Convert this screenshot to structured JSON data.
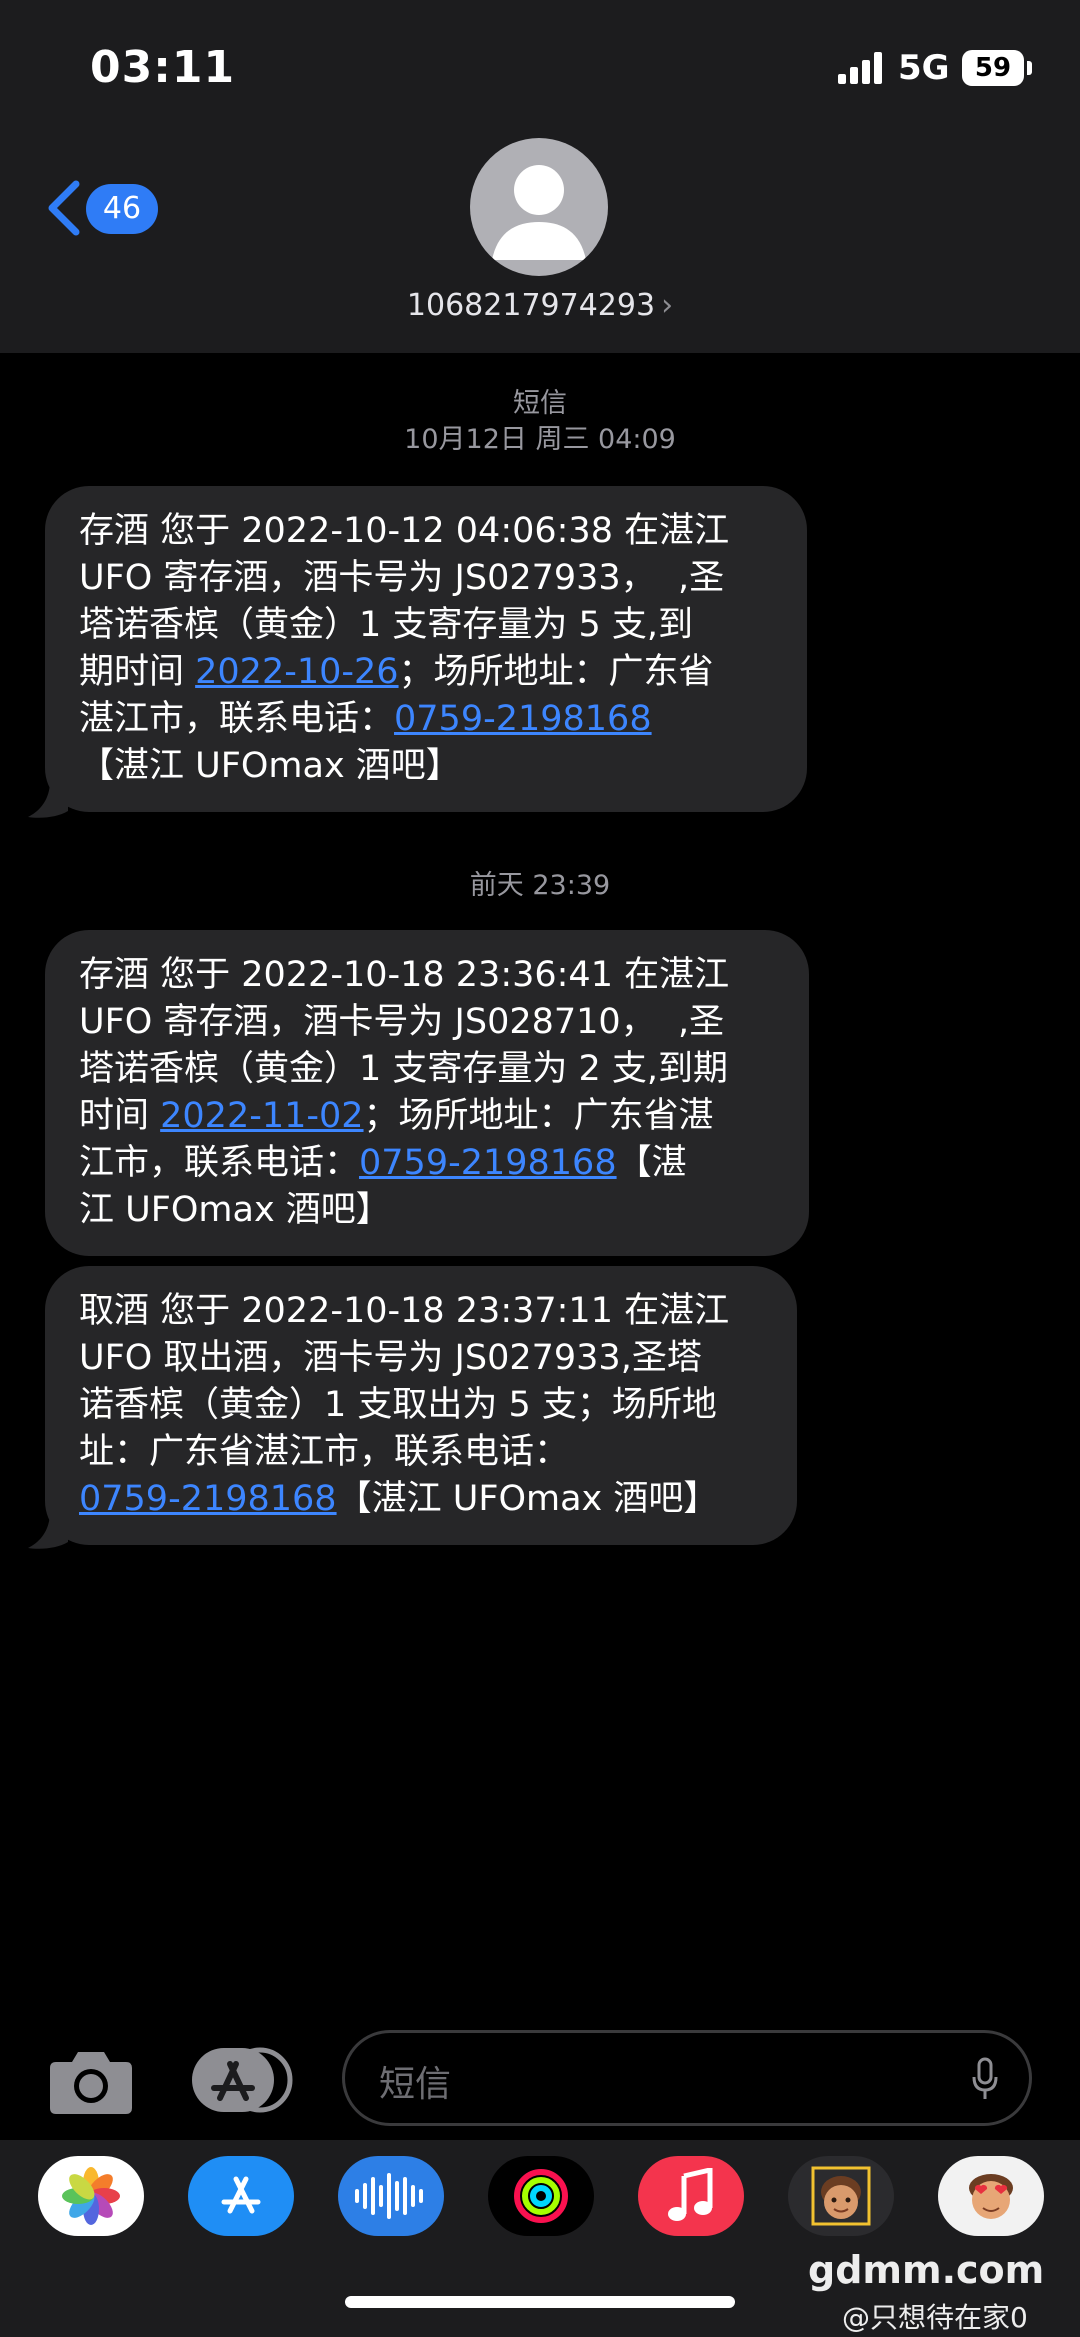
{
  "status_bar": {
    "time": "03:11",
    "network": "5G",
    "battery": "59"
  },
  "header": {
    "back_count": "46",
    "contact": "1068217974293",
    "contact_chevron": "›"
  },
  "thread": {
    "service_label": "短信",
    "first_timestamp": "10月12日 周三 04:09",
    "second_timestamp": "前天 23:39",
    "messages": [
      {
        "pre": "存酒 您于 2022-10-12 04:06:38 在湛江\nUFO 寄存酒，酒卡号为 JS027933，  ,圣\n塔诺香槟（黄金）1 支寄存量为 5 支,到\n期时间 ",
        "link1": "2022-10-26",
        "mid": "；场所地址：广东省\n湛江市，联系电话：",
        "link2": "0759-2198168",
        "post": "\n【湛江 UFOmax 酒吧】"
      },
      {
        "pre": "存酒 您于 2022-10-18 23:36:41 在湛江\nUFO 寄存酒，酒卡号为 JS028710，  ,圣\n塔诺香槟（黄金）1 支寄存量为 2 支,到期\n时间 ",
        "link1": "2022-11-02",
        "mid": "；场所地址：广东省湛\n江市，联系电话：",
        "link2": "0759-2198168",
        "post": "【湛\n江 UFOmax 酒吧】"
      },
      {
        "pre": "取酒 您于 2022-10-18 23:37:11 在湛江\nUFO 取出酒，酒卡号为 JS027933,圣塔\n诺香槟（黄金）1 支取出为 5 支；场所地\n址：广东省湛江市，联系电话：\n",
        "link2": "0759-2198168",
        "post": "【湛江 UFOmax 酒吧】"
      }
    ]
  },
  "composer": {
    "placeholder": "短信"
  },
  "watermark": {
    "site": "gdmm.com",
    "user": "@只想待在家0"
  },
  "colors": {
    "accent": "#2f7cf6",
    "link": "#3d86ff",
    "bubble": "#262628",
    "header_bg": "#1c1c1e"
  },
  "dock_apps": [
    "photos-icon",
    "app-store-icon",
    "audio-waveform-icon",
    "fitness-rings-icon",
    "music-icon",
    "memoji-boy-icon",
    "memoji-heart-eyes-icon"
  ]
}
